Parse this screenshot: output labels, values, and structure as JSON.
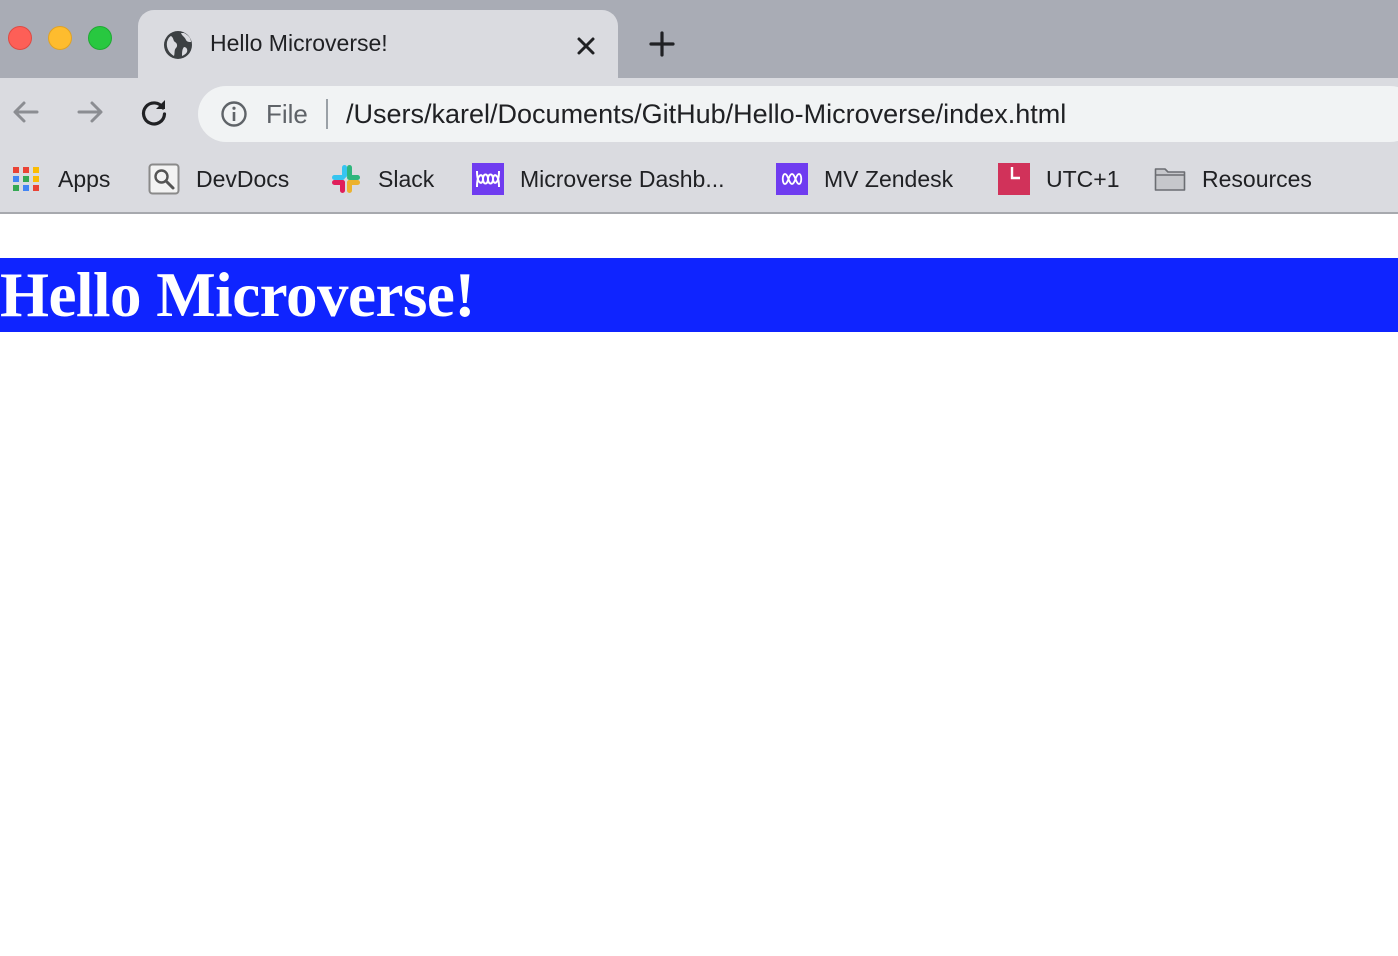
{
  "window": {
    "traffic_lights": [
      "close",
      "minimize",
      "zoom"
    ]
  },
  "tab": {
    "title": "Hello Microverse!",
    "icon": "globe-icon"
  },
  "toolbar": {
    "scheme_label": "File",
    "url": "/Users/karel/Documents/GitHub/Hello-Microverse/index.html"
  },
  "bookmarks": {
    "items": [
      {
        "label": "Apps",
        "icon": "apps-grid-icon"
      },
      {
        "label": "DevDocs",
        "icon": "devdocs-icon"
      },
      {
        "label": "Slack",
        "icon": "slack-icon"
      },
      {
        "label": "Microverse Dashb...",
        "icon": "microverse-icon"
      },
      {
        "label": "MV Zendesk",
        "icon": "microverse-icon"
      },
      {
        "label": "UTC+1",
        "icon": "clock-l-icon"
      },
      {
        "label": "Resources",
        "icon": "folder-icon"
      }
    ]
  },
  "page": {
    "heading": "Hello Microverse!",
    "heading_background": "#0f24ff",
    "heading_color": "#ffffff"
  }
}
